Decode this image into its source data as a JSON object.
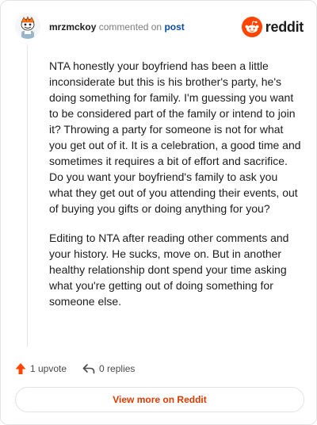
{
  "comment": {
    "author": "mrzmckoy",
    "verb": "commented on",
    "target_link": "post",
    "paragraphs": [
      "NTA honestly your boyfriend has been a little inconsiderate but this is his brother's party, he's doing something for family. I'm guessing you want to be considered part of the family or intend to join it? Throwing a party for someone is not for what you get out of it. It is a celebration, a good time and sometimes it requires a bit of effort and sacrifice. Do you want your boyfriend's family to ask you what they get out of you attending their events, out of buying you gifts or doing anything for you?",
      "Editing to NTA after reading other comments and your history. He sucks, move on. But in another healthy relationship dont spend your time asking what you're getting out of doing something for someone else."
    ]
  },
  "brand": {
    "wordmark": "reddit",
    "icon": "reddit-snoo-icon",
    "color": "#ff4500"
  },
  "actions": {
    "upvote_label": "1 upvote",
    "upvote_icon": "upvote-arrow-icon",
    "upvote_color": "#ff4500",
    "replies_label": "0 replies",
    "replies_icon": "reply-arrow-icon"
  },
  "footer": {
    "view_more_label": "View more on Reddit",
    "accent": "#d93a00"
  }
}
